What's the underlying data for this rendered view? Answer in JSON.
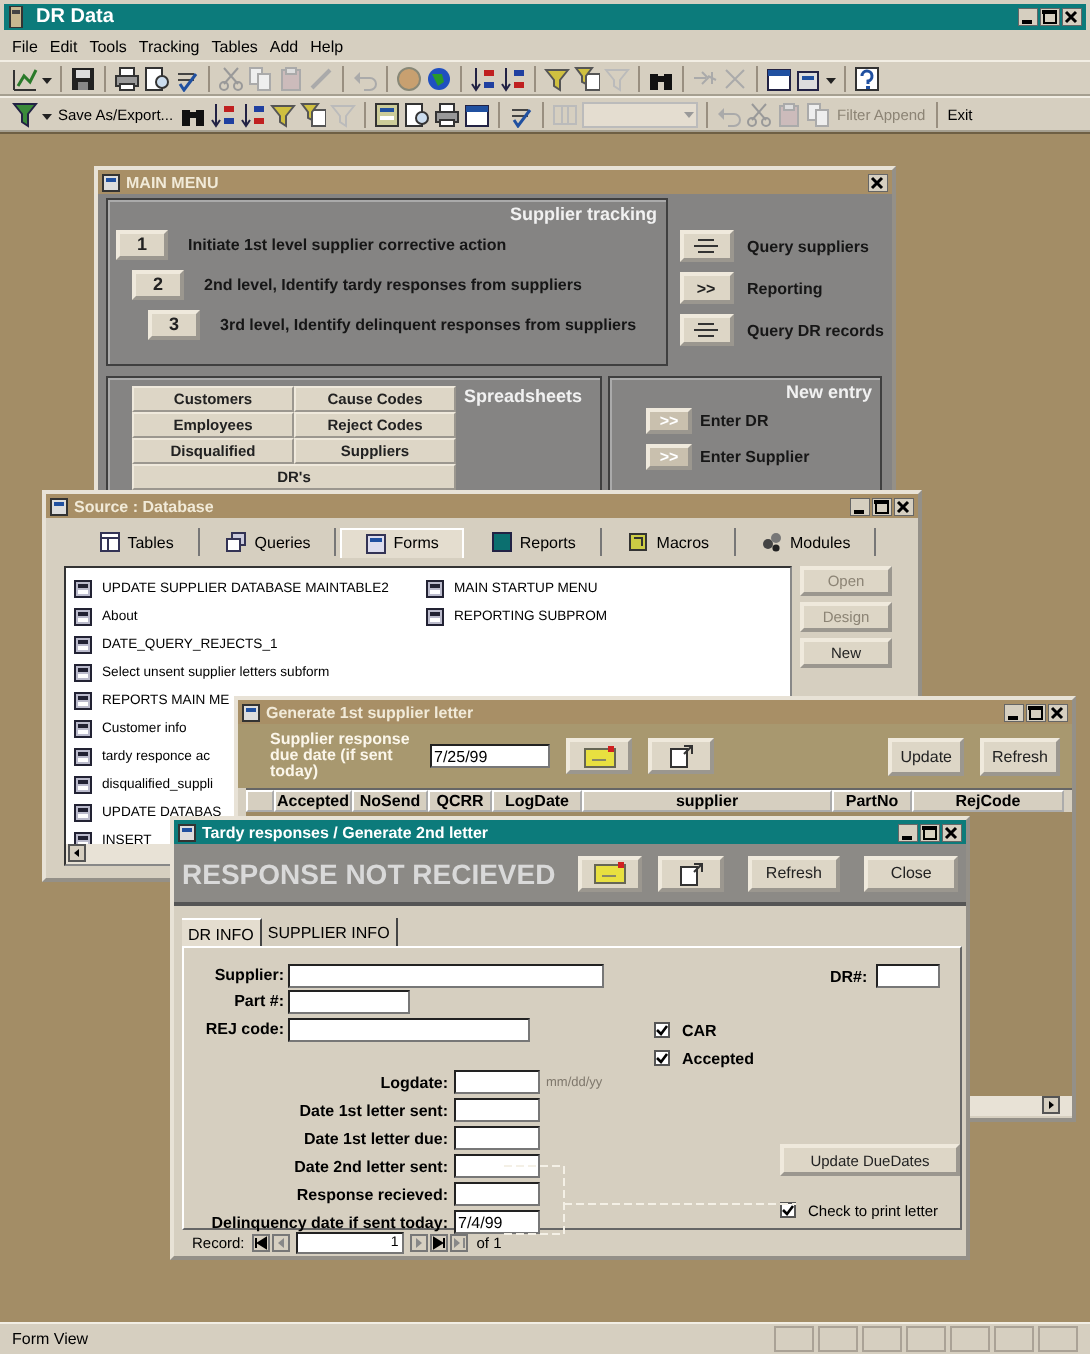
{
  "window": {
    "title": "DR Data"
  },
  "menu": [
    "File",
    "Edit",
    "Tools",
    "Tracking",
    "Tables",
    "Add",
    "Help"
  ],
  "toolbar_2": {
    "save_as": "Save As/Export...",
    "append": {
      "label": "Filter Append",
      "disabled": true
    },
    "exit": "Exit"
  },
  "main_menu": {
    "title": "MAIN MENU",
    "supplier_tracking": {
      "heading": "Supplier tracking",
      "steps": [
        {
          "button": "1",
          "label": "Initiate 1st level supplier corrective action"
        },
        {
          "button": "2",
          "label": "2nd level, Identify tardy responses from suppliers"
        },
        {
          "button": "3",
          "label": "3rd level, Identify delinquent responses from suppliers"
        }
      ]
    },
    "queries": [
      {
        "kind": "form",
        "label": "Query suppliers"
      },
      {
        "kind": "arrows",
        "button": ">>",
        "label": "Reporting"
      },
      {
        "kind": "form",
        "label": "Query DR records"
      }
    ],
    "spreadsheets": {
      "heading": "Spreadsheets",
      "buttons": [
        "Customers",
        "Cause Codes",
        "Employees",
        "Reject Codes",
        "Disqualified",
        "Suppliers",
        "DR's"
      ]
    },
    "new_entry": {
      "heading": "New entry",
      "items": [
        {
          "button": ">>",
          "label": "Enter DR"
        },
        {
          "button": ">>",
          "label": "Enter Supplier"
        }
      ]
    }
  },
  "database_window": {
    "title": "Source : Database",
    "tabs": [
      {
        "label": "Tables",
        "selected": false
      },
      {
        "label": "Queries",
        "selected": false
      },
      {
        "label": "Forms",
        "selected": true
      },
      {
        "label": "Reports",
        "selected": false
      },
      {
        "label": "Macros",
        "selected": false
      },
      {
        "label": "Modules",
        "selected": false
      }
    ],
    "list_columns": [
      [
        "UPDATE SUPPLIER DATABASE MAINTABLE2",
        "About",
        "DATE_QUERY_REJECTS_1",
        "Select unsent supplier letters subform",
        "REPORTS MAIN ME",
        "Customer info",
        "tardy responce ac",
        "disqualified_suppli",
        "UPDATE DATABAS",
        "INSERT"
      ],
      [
        "MAIN STARTUP MENU",
        "REPORTING SUBPROM"
      ]
    ],
    "buttons": [
      {
        "label": "Open",
        "disabled": true
      },
      {
        "label": "Design",
        "disabled": true
      },
      {
        "label": "New",
        "disabled": false
      }
    ]
  },
  "letter_window": {
    "title": "Generate 1st supplier letter",
    "due_label": "Supplier response due date (if sent today)",
    "due_value": "7/25/99",
    "buttons": [
      "Update",
      "Refresh"
    ],
    "columns": [
      "Accepted",
      "NoSend",
      "QCRR",
      "LogDate",
      "supplier",
      "PartNo",
      "RejCode"
    ]
  },
  "tardy_window": {
    "title": "Tardy responses / Generate 2nd letter",
    "heading": "RESPONSE NOT RECIEVED",
    "buttons": [
      "Refresh",
      "Close"
    ],
    "tabs": [
      {
        "label": "DR INFO",
        "selected": true
      },
      {
        "label": "SUPPLIER INFO",
        "selected": false
      }
    ],
    "fields": [
      {
        "label": "Supplier:"
      },
      {
        "label": "Part #:"
      },
      {
        "label": "REJ code:"
      }
    ],
    "dr_label": "DR#:",
    "checks": [
      {
        "label": "CAR",
        "checked": true
      },
      {
        "label": "Accepted",
        "checked": true
      }
    ],
    "dates": [
      {
        "label": "Logdate:",
        "note": "mm/dd/yy"
      },
      {
        "label": "Date 1st letter sent:"
      },
      {
        "label": "Date 1st letter due:"
      },
      {
        "label": "Date 2nd letter sent:"
      },
      {
        "label": "Response recieved:"
      },
      {
        "label": "Delinquency date if sent today:",
        "value": "7/4/99"
      }
    ],
    "update_button": "Update DueDates",
    "print_check": {
      "label": "Check to print letter",
      "checked": true
    },
    "record_nav": {
      "label": "Record:",
      "value": "1",
      "total": "of 1"
    }
  },
  "status_bar": {
    "text": "Form View"
  }
}
